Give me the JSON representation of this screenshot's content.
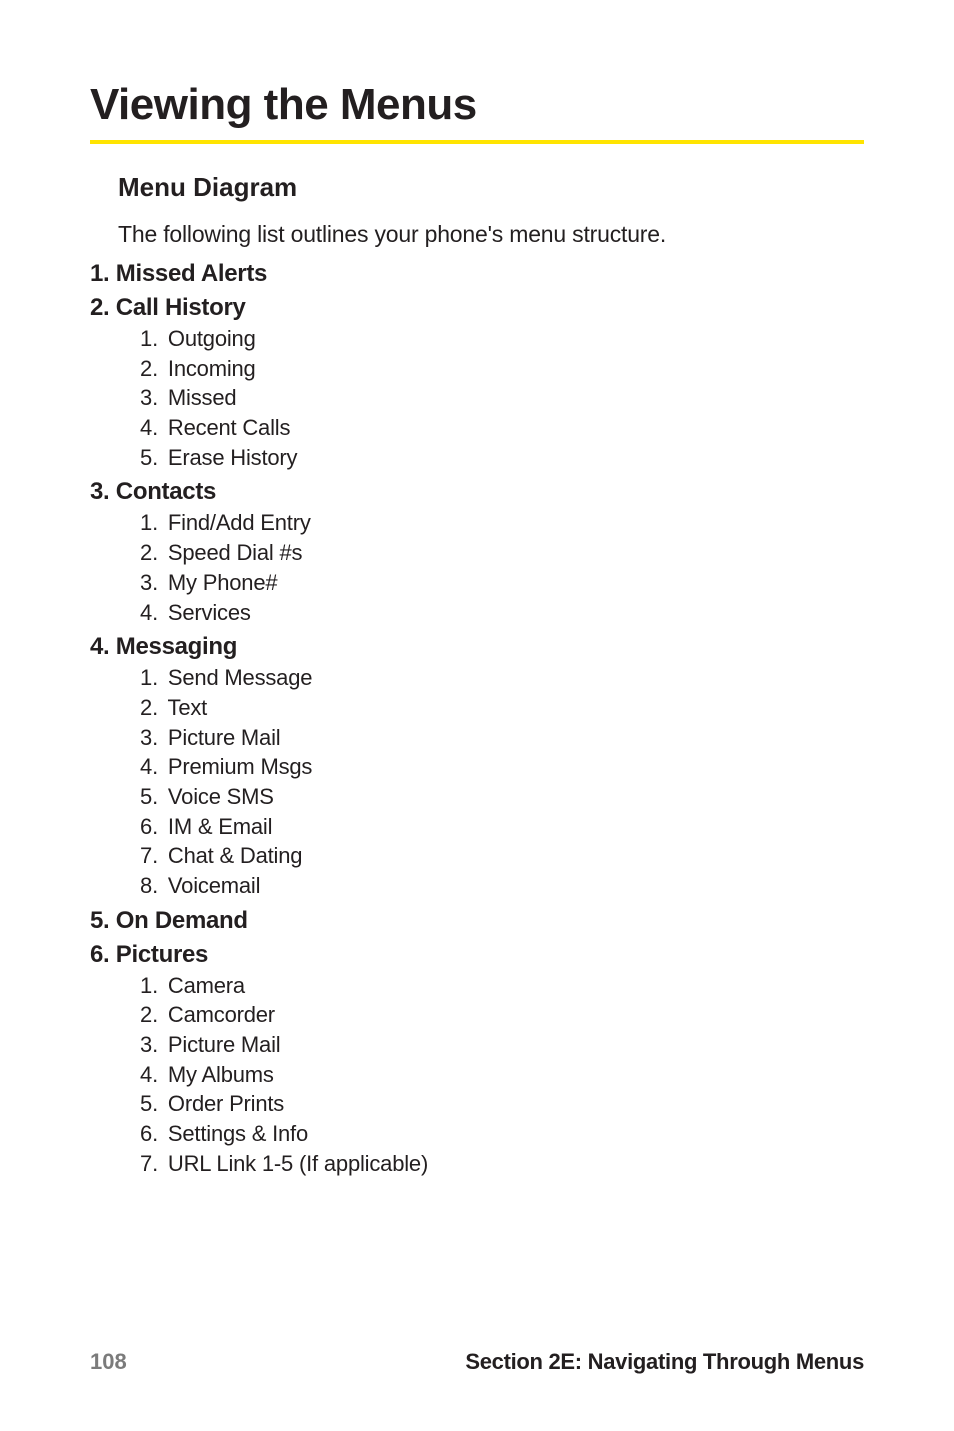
{
  "title": "Viewing the Menus",
  "subhead": "Menu Diagram",
  "intro": "The following list outlines your phone's menu structure.",
  "menu": [
    {
      "n": "1.",
      "label": "Missed Alerts",
      "items": []
    },
    {
      "n": "2.",
      "label": "Call History",
      "items": [
        {
          "n": "1.",
          "label": "Outgoing"
        },
        {
          "n": "2.",
          "label": "Incoming"
        },
        {
          "n": "3.",
          "label": "Missed"
        },
        {
          "n": "4.",
          "label": "Recent Calls"
        },
        {
          "n": "5.",
          "label": "Erase History"
        }
      ]
    },
    {
      "n": "3.",
      "label": "Contacts",
      "items": [
        {
          "n": "1.",
          "label": "Find/Add Entry"
        },
        {
          "n": "2.",
          "label": "Speed Dial #s"
        },
        {
          "n": "3.",
          "label": "My Phone#"
        },
        {
          "n": "4.",
          "label": "Services"
        }
      ]
    },
    {
      "n": "4.",
      "label": "Messaging",
      "items": [
        {
          "n": "1.",
          "label": "Send Message"
        },
        {
          "n": "2.",
          "label": "Text"
        },
        {
          "n": "3.",
          "label": "Picture Mail"
        },
        {
          "n": "4.",
          "label": "Premium Msgs"
        },
        {
          "n": "5.",
          "label": "Voice SMS"
        },
        {
          "n": "6.",
          "label": "IM & Email"
        },
        {
          "n": "7.",
          "label": "Chat & Dating"
        },
        {
          "n": "8.",
          "label": "Voicemail"
        }
      ]
    },
    {
      "n": "5.",
      "label": "On Demand",
      "items": []
    },
    {
      "n": "6.",
      "label": "Pictures",
      "items": [
        {
          "n": "1.",
          "label": "Camera"
        },
        {
          "n": "2.",
          "label": "Camcorder"
        },
        {
          "n": "3.",
          "label": "Picture Mail"
        },
        {
          "n": "4.",
          "label": "My Albums"
        },
        {
          "n": "5.",
          "label": "Order Prints"
        },
        {
          "n": "6.",
          "label": "Settings & Info"
        },
        {
          "n": "7.",
          "label": "URL Link 1-5 (If applicable)"
        }
      ]
    }
  ],
  "footer": {
    "page": "108",
    "section": "Section 2E: Navigating Through Menus"
  }
}
